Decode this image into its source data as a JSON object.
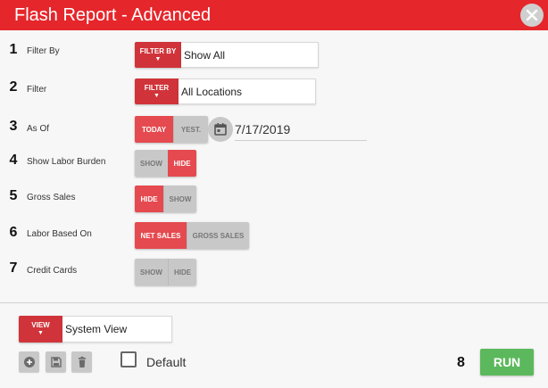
{
  "dialog": {
    "title": "Flash Report - Advanced"
  },
  "rows": [
    {
      "num": "1",
      "label": "Filter By",
      "button": "FILTER BY",
      "value": "Show All"
    },
    {
      "num": "2",
      "label": "Filter",
      "button": "FILTER",
      "value": "All Locations"
    },
    {
      "num": "3",
      "label": "As Of",
      "options": [
        "TODAY",
        "YEST."
      ],
      "selected": "TODAY",
      "date": "7/17/2019"
    },
    {
      "num": "4",
      "label": "Show Labor Burden",
      "options": [
        "SHOW",
        "HIDE"
      ],
      "selected": "HIDE"
    },
    {
      "num": "5",
      "label": "Gross Sales",
      "options": [
        "HIDE",
        "SHOW"
      ],
      "selected": "HIDE"
    },
    {
      "num": "6",
      "label": "Labor Based On",
      "options": [
        "NET SALES",
        "GROSS SALES"
      ],
      "selected": "NET SALES"
    },
    {
      "num": "7",
      "label": "Credit Cards",
      "options": [
        "SHOW",
        "HIDE"
      ],
      "selected": "none"
    }
  ],
  "footer": {
    "view_button": "VIEW",
    "view_value": "System View",
    "icons": [
      "add-icon",
      "save-icon",
      "trash-icon"
    ],
    "default_label": "Default",
    "default_checked": false,
    "run_num": "8",
    "run_label": "RUN"
  },
  "colors": {
    "header": "#e5262b",
    "accent": "#d0343a",
    "toggle_on": "#e44a4f",
    "run": "#5cb85c"
  }
}
